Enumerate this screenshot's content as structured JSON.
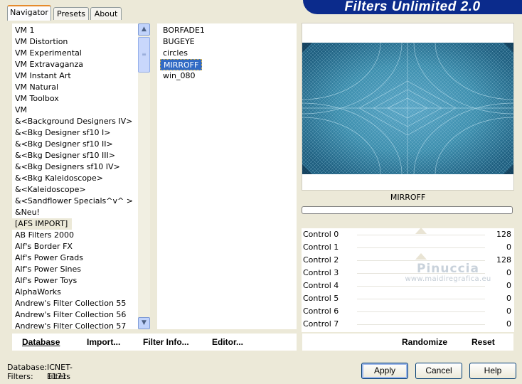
{
  "tabs": [
    {
      "label": "Navigator",
      "active": true
    },
    {
      "label": "Presets",
      "active": false
    },
    {
      "label": "About",
      "active": false
    }
  ],
  "banner": "Filters Unlimited 2.0",
  "categories": [
    "VM 1",
    "VM Distortion",
    "VM Experimental",
    "VM Extravaganza",
    "VM Instant Art",
    "VM Natural",
    "VM Toolbox",
    "VM",
    "&<Background Designers IV>",
    "&<Bkg Designer sf10 I>",
    "&<Bkg Designer sf10 II>",
    "&<Bkg Designer sf10 III>",
    "&<Bkg Designers sf10 IV>",
    "&<Bkg Kaleidoscope>",
    "&<Kaleidoscope>",
    "&<Sandflower Specials^v^ >",
    "&Neu!",
    "[AFS IMPORT]",
    "AB Filters 2000",
    "Alf's Border FX",
    "Alf's Power Grads",
    "Alf's Power Sines",
    "Alf's Power Toys",
    "AlphaWorks",
    "Andrew's Filter Collection 55",
    "Andrew's Filter Collection 56",
    "Andrew's Filter Collection 57"
  ],
  "highlighted_category": "[AFS IMPORT]",
  "filters": [
    "BORFADE1",
    "BUGEYE",
    "circles",
    "MIRROFF",
    "win_080"
  ],
  "selected_filter": "MIRROFF",
  "preview_filter_name": "MIRROFF",
  "controls": [
    {
      "name": "Control 0",
      "value": "128"
    },
    {
      "name": "Control 1",
      "value": "0"
    },
    {
      "name": "Control 2",
      "value": "128"
    },
    {
      "name": "Control 3",
      "value": "0"
    },
    {
      "name": "Control 4",
      "value": "0"
    },
    {
      "name": "Control 5",
      "value": "0"
    },
    {
      "name": "Control 6",
      "value": "0"
    },
    {
      "name": "Control 7",
      "value": "0"
    }
  ],
  "watermark": {
    "line1": "Pinuccia",
    "line2": "www.maidiregrafica.eu"
  },
  "left_buttons": {
    "database": "Database",
    "import": "Import...",
    "filter_info": "Filter Info...",
    "editor": "Editor..."
  },
  "right_buttons": {
    "randomize": "Randomize",
    "reset": "Reset"
  },
  "status": {
    "database_label": "Database:",
    "database_value": "ICNET-Filters",
    "filters_label": "Filters:",
    "filters_value": "1171"
  },
  "dialog_buttons": {
    "apply": "Apply",
    "cancel": "Cancel",
    "help": "Help"
  },
  "colors": {
    "selection": "#316ac5",
    "banner": "#0b2b8c",
    "preview_base": "#3e8fae"
  },
  "icons": {
    "scroll_up": "chevron-up-icon",
    "scroll_down": "chevron-down-icon"
  }
}
